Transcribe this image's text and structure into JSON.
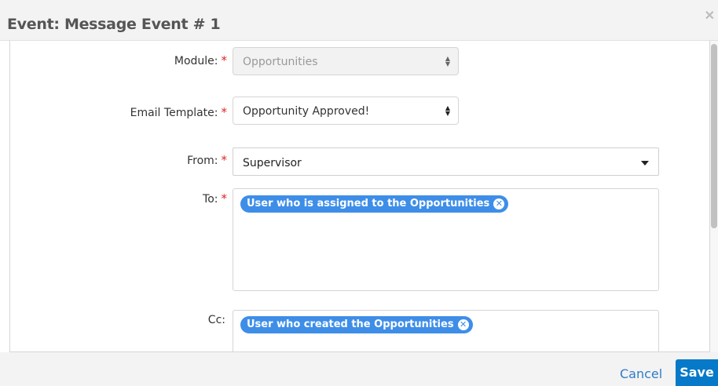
{
  "dialog": {
    "title": "Event: Message Event # 1",
    "close_glyph": "✕"
  },
  "form": {
    "module": {
      "label": "Module:",
      "required_mark": "*",
      "value": "Opportunities"
    },
    "email_template": {
      "label": "Email Template:",
      "required_mark": "*",
      "value": "Opportunity Approved!"
    },
    "from": {
      "label": "From:",
      "required_mark": "*",
      "value": "Supervisor"
    },
    "to": {
      "label": "To:",
      "required_mark": "*",
      "tags": [
        "User who is assigned to the Opportunities"
      ]
    },
    "cc": {
      "label": "Cc:",
      "tags": [
        "User who created the Opportunities"
      ]
    }
  },
  "footer": {
    "cancel_label": "Cancel",
    "save_label": "Save"
  },
  "colors": {
    "accent": "#0679c8",
    "tag": "#3e8ee8",
    "required": "#e02424"
  }
}
